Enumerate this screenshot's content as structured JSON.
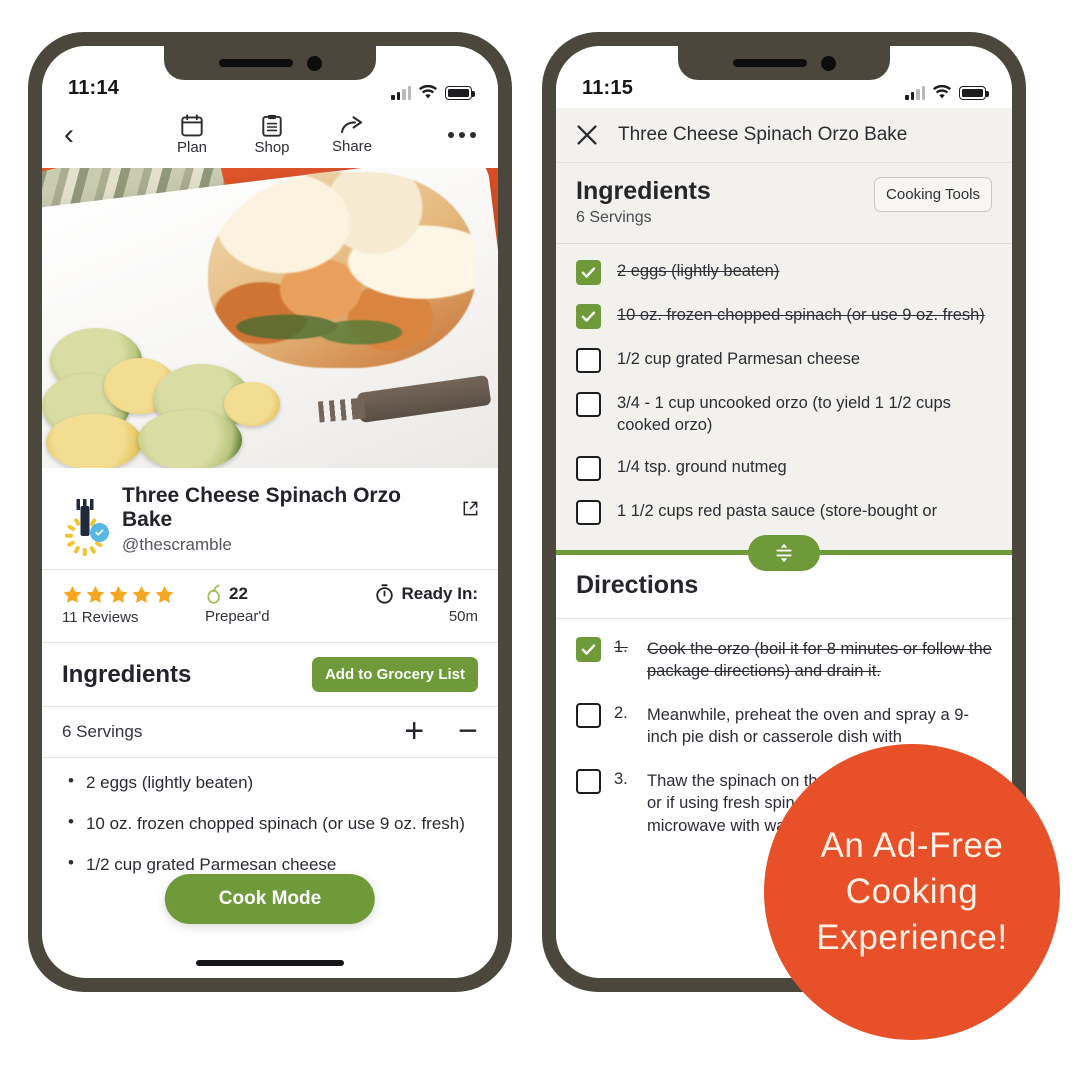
{
  "left_phone": {
    "status": {
      "time": "11:14"
    },
    "actionbar": {
      "back_label": "",
      "actions": [
        {
          "label": "Plan",
          "icon": "calendar-icon"
        },
        {
          "label": "Shop",
          "icon": "clipboard-icon"
        },
        {
          "label": "Share",
          "icon": "share-arrow-icon"
        }
      ],
      "more_label": ""
    },
    "recipe": {
      "title": "Three Cheese Spinach Orzo Bake",
      "handle": "@thescramble"
    },
    "stats": {
      "stars": 5,
      "reviews": "11 Reviews",
      "prepeard_count": "22",
      "prepeard_label": "Prepear'd",
      "ready_label": "Ready In:",
      "ready_value": "50m"
    },
    "ingredients": {
      "heading": "Ingredients",
      "add_button": "Add to Grocery List",
      "servings": "6 Servings",
      "plus": "+",
      "minus": "−",
      "items": [
        "2   eggs  (lightly beaten)",
        "10  oz.  frozen chopped spinach  (or use 9 oz. fresh)",
        "1/2  cup  grated Parmesan cheese"
      ]
    },
    "cook_mode_button": "Cook Mode"
  },
  "right_phone": {
    "status": {
      "time": "11:15"
    },
    "topbar": {
      "title": "Three Cheese Spinach Orzo Bake"
    },
    "ingredients": {
      "heading": "Ingredients",
      "servings": "6 Servings",
      "tools_button": "Cooking Tools",
      "items": [
        {
          "text": "2   eggs  (lightly beaten)",
          "checked": true
        },
        {
          "text": "10  oz.  frozen chopped spinach  (or use 9 oz. fresh)",
          "checked": true
        },
        {
          "text": "1/2  cup  grated Parmesan cheese",
          "checked": false
        },
        {
          "text": "3/4 - 1  cup  uncooked orzo  (to yield 1 1/2 cups cooked orzo)",
          "checked": false
        },
        {
          "text": "1/4  tsp.  ground nutmeg",
          "checked": false
        },
        {
          "text": "1 1/2  cups  red pasta sauce  (store-bought or",
          "checked": false
        }
      ]
    },
    "directions": {
      "heading": "Directions",
      "steps": [
        {
          "num": "1.",
          "text": "Cook the orzo (boil it for 8 minutes or follow the package directions) and drain it.",
          "checked": true
        },
        {
          "num": "2.",
          "text": "Meanwhile, preheat the oven and spray a 9-inch pie dish or casserole dish with",
          "checked": false
        },
        {
          "num": "3.",
          "text": "Thaw the spinach on the stovetop and drain it, or if using fresh spinach, wilt it in a pan or microwave with water, then coarsely chop it.",
          "checked": false
        }
      ]
    }
  },
  "ad_badge": {
    "line1": "An Ad-Free",
    "line2": "Cooking",
    "line3": "Experience!"
  },
  "colors": {
    "frame": "#4b473c",
    "green": "#6f9a39",
    "orange": "#e8502a",
    "star": "#f5a623",
    "panel": "#f2f1ed"
  }
}
